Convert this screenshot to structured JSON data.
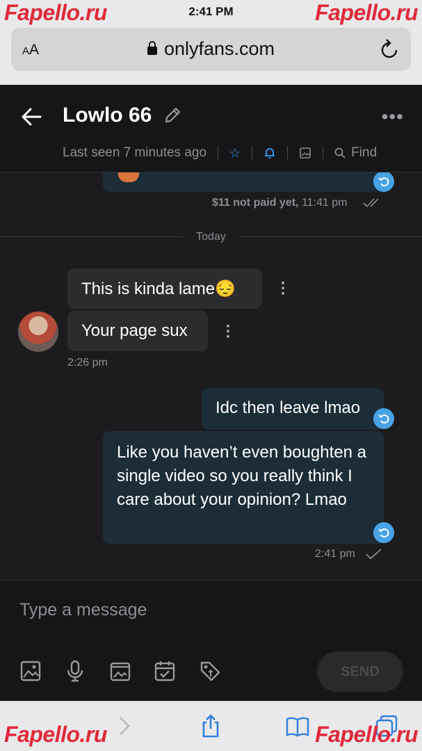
{
  "status": {
    "time": "2:41 PM"
  },
  "browser": {
    "aa_label": "A",
    "aa_label_big": "A",
    "url": "onlyfans.com"
  },
  "header": {
    "contact_name": "Lowlo 66",
    "last_seen": "Last seen 7 minutes ago",
    "find_label": "Find"
  },
  "messages": {
    "prev_meta_status": "$11 not paid yet,",
    "prev_meta_time": "11:41 pm",
    "day_divider": "Today",
    "incoming": [
      {
        "text": "This is kinda lame😔"
      },
      {
        "text": "Your page sux"
      }
    ],
    "incoming_time": "2:26 pm",
    "outgoing": [
      {
        "text": "Idc then leave lmao"
      },
      {
        "text": "Like you haven’t even boughten a single video so you really think I care about your opinion? Lmao"
      }
    ],
    "outgoing_time": "2:41 pm"
  },
  "composer": {
    "placeholder": "Type a message",
    "send_label": "SEND"
  },
  "watermark": "Fapello.ru",
  "colors": {
    "accent": "#47a3e6",
    "outgoing_bubble": "#1c2d38",
    "incoming_bubble": "#2c2c2e",
    "watermark": "#e02a3a"
  }
}
